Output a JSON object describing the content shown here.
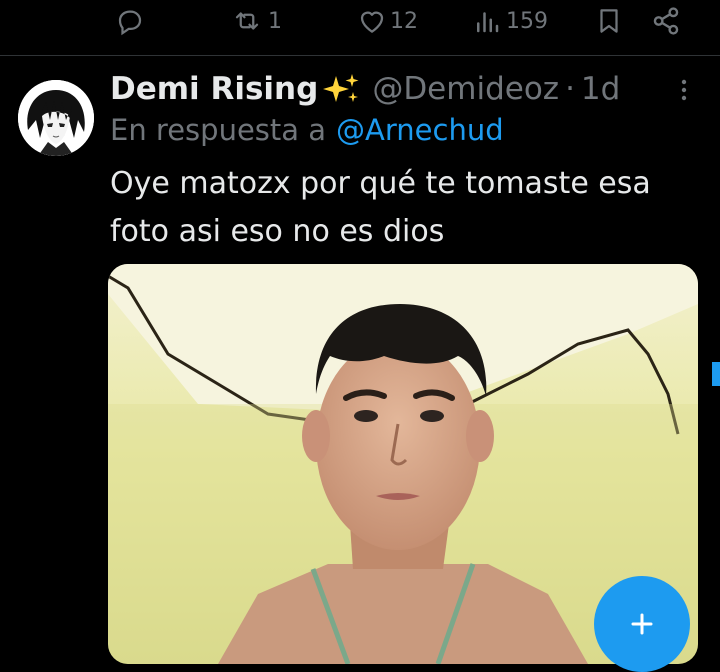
{
  "previous_tweet_actions": {
    "reply_icon": "reply-icon",
    "retweet_count": "1",
    "like_count": "12",
    "views_count": "159",
    "bookmark_icon": "bookmark-icon",
    "share_icon": "share-icon"
  },
  "tweet": {
    "author_name": "Demi Rising",
    "author_emoji": "sparkles-icon",
    "handle": "@Demideoz",
    "separator": "·",
    "time": "1d",
    "reply_prefix": "En respuesta a",
    "reply_to": "@Arnechud",
    "text": "Oye matozx por qué te tomaste esa foto asi eso no es dios",
    "media": "photo-selfie"
  },
  "colors": {
    "background": "#000000",
    "text": "#e7e9ea",
    "muted": "#71767b",
    "accent": "#1d9bf0",
    "divider": "#2f3336"
  },
  "fab": {
    "icon": "plus-icon"
  }
}
